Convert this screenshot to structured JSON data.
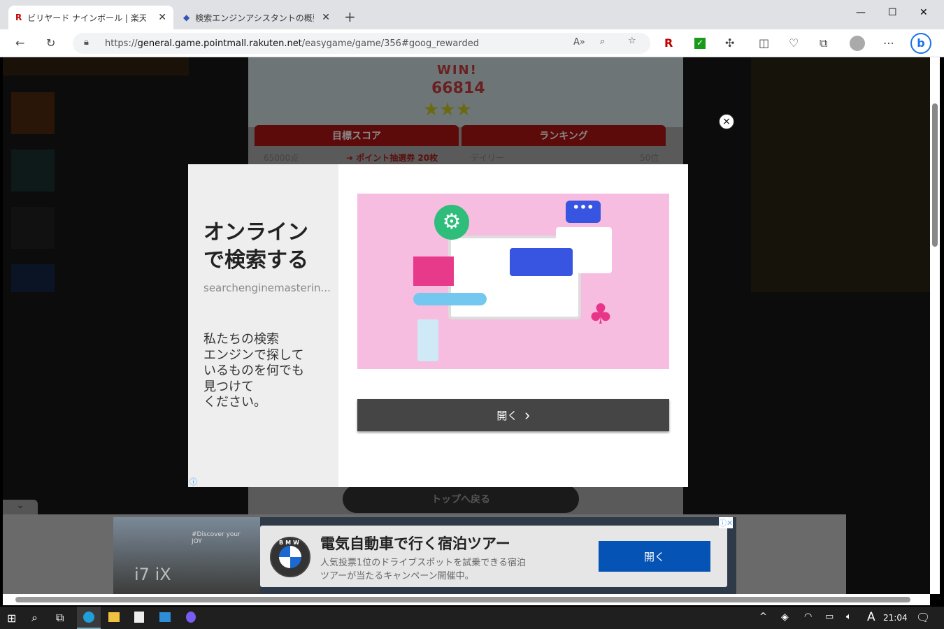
{
  "browser": {
    "tabs": [
      {
        "label": "ビリヤード ナインボール | 楽天ポイント",
        "icon": "rakuten-icon",
        "active": true
      },
      {
        "label": "検索エンジンアシスタントの概要:個人",
        "icon": "extension-icon",
        "active": false
      }
    ],
    "url_prefix": "https://",
    "url_domain": "general.game.pointmall.rakuten.net",
    "url_path": "/easygame/game/356#goog_rewarded"
  },
  "game": {
    "win": "WIN!",
    "score": "66814",
    "target_label": "目標スコア",
    "ranking_label": "ランキング",
    "target_score": "65000点",
    "reward": "➔ ポイント抽選券 20枚",
    "ranking_type": "デイリー",
    "rank": "50位",
    "back_button": "トップへ戻る"
  },
  "modal": {
    "title": "オンライン\nで検索する",
    "source": "searchenginemasterin...",
    "description": "私たちの検索\nエンジンで探して\nいるものを何でも\n見つけて\nください。",
    "open_button": "開く",
    "close": "×",
    "info": "ⓘ"
  },
  "bottom_ad": {
    "image_text": "i7 iX",
    "tag": "#Discover your JOY",
    "headline": "電気自動車で行く宿泊ツアー",
    "body": "人気投票1位のドライブスポットを試乗できる宿泊\nツアーが当たるキャンペーン開催中。",
    "button": "開く",
    "brand": "BMW"
  },
  "taskbar": {
    "time": "21:04",
    "ime": "A"
  },
  "colors": {
    "accent": "#0653b6",
    "modal_button": "#454545",
    "ad_image_bg": "#f7bde0"
  }
}
